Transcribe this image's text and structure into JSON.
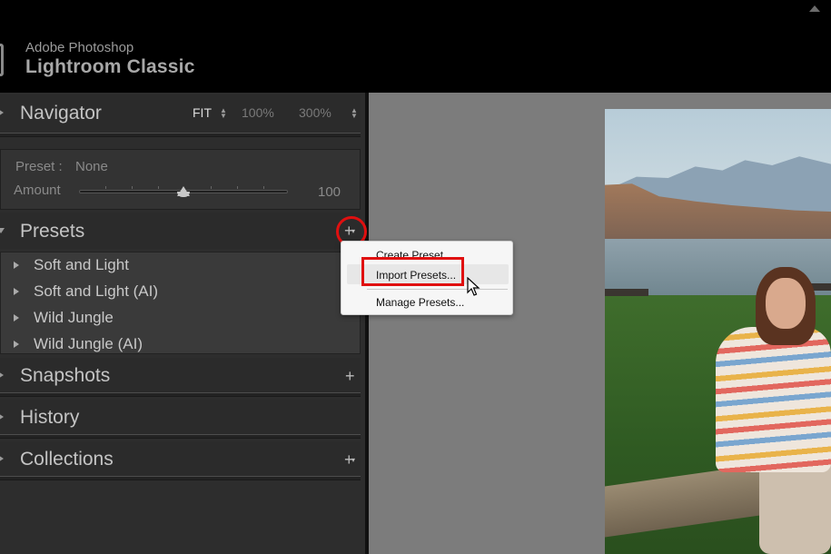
{
  "app": {
    "vendor": "Adobe Photoshop",
    "product": "Lightroom Classic"
  },
  "navigator": {
    "title": "Navigator",
    "zoom_fit": "FIT",
    "zoom_100": "100%",
    "zoom_300": "300%"
  },
  "preset_amount": {
    "preset_label": "Preset :",
    "preset_value": "None",
    "amount_label": "Amount",
    "amount_value": "100",
    "amount_level": 0.5
  },
  "presets": {
    "title": "Presets",
    "items": [
      {
        "label": "Soft and Light"
      },
      {
        "label": "Soft and Light (AI)"
      },
      {
        "label": "Wild Jungle"
      },
      {
        "label": "Wild Jungle (AI)"
      }
    ]
  },
  "snapshots": {
    "title": "Snapshots"
  },
  "history": {
    "title": "History"
  },
  "collections": {
    "title": "Collections"
  },
  "context_menu": {
    "create": "Create Preset...",
    "import": "Import Presets...",
    "manage": "Manage Presets..."
  },
  "icons": {
    "plus": "+",
    "dropdown": "▾",
    "updown": "⬍"
  },
  "colors": {
    "highlight_red": "#e01010",
    "panel_bg": "#2d2d2d",
    "content_bg": "#7c7c7c"
  }
}
